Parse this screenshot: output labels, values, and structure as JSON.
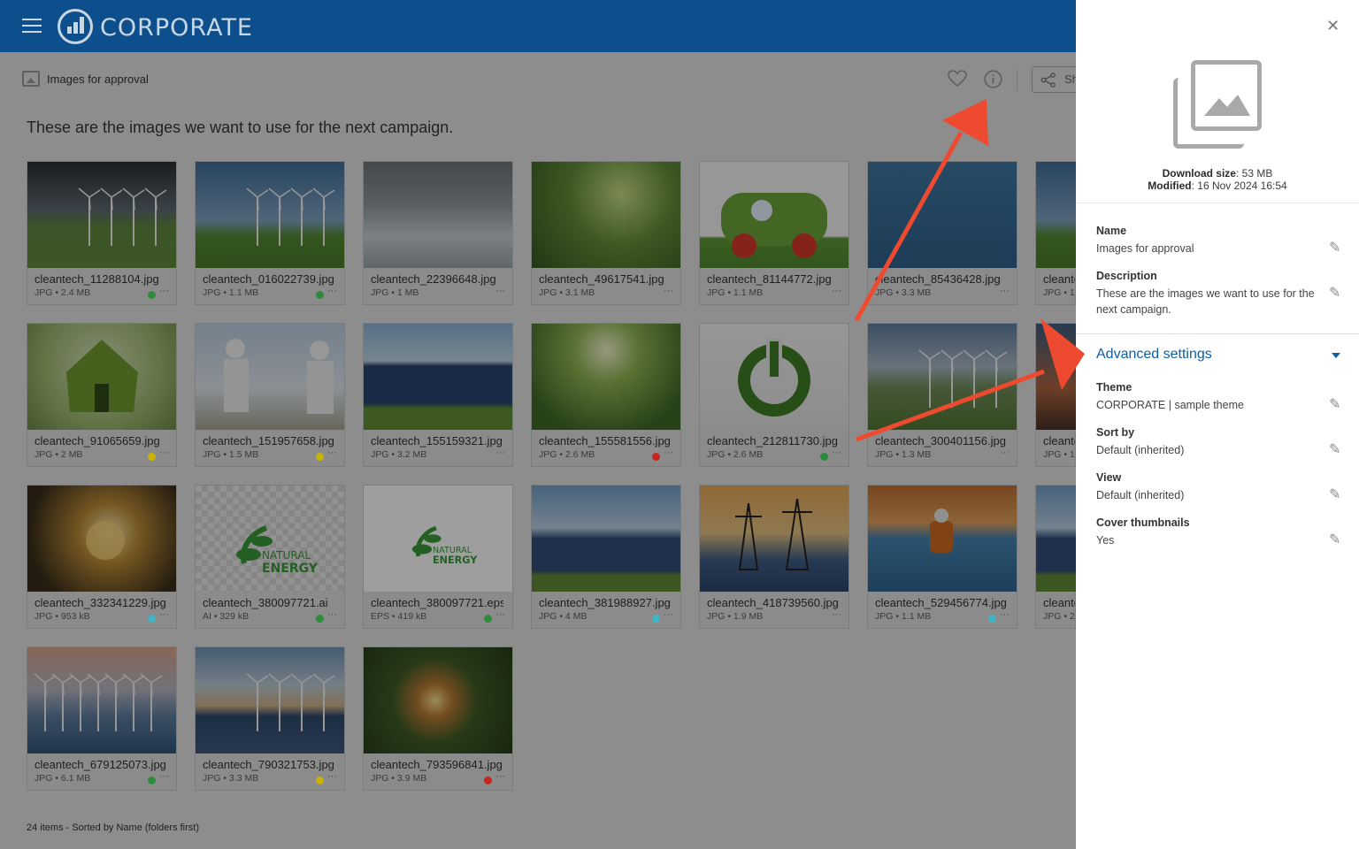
{
  "app": {
    "logo_text": "CORPORATE"
  },
  "breadcrumb": {
    "label": "Images for approval"
  },
  "toolbar": {
    "share_label": "Sh"
  },
  "description": "These are the images we want to use for the next campaign.",
  "files": [
    {
      "name": "cleantech_11288104.jpg",
      "meta": "JPG • 2.4 MB",
      "status": "#2e8b3a",
      "thumb": "storm"
    },
    {
      "name": "cleantech_016022739.jpg",
      "meta": "JPG • 1.1 MB",
      "status": "#2e8b3a",
      "thumb": "turbines"
    },
    {
      "name": "cleantech_22396648.jpg",
      "meta": "JPG • 1 MB",
      "status": "",
      "thumb": "dam"
    },
    {
      "name": "cleantech_49617541.jpg",
      "meta": "JPG • 3.1 MB",
      "status": "",
      "thumb": "forest"
    },
    {
      "name": "cleantech_81144772.jpg",
      "meta": "JPG • 1.1 MB",
      "status": "",
      "thumb": "flowercar"
    },
    {
      "name": "cleantech_85436428.jpg",
      "meta": "JPG • 3.3 MB",
      "status": "",
      "thumb": "solarsea"
    },
    {
      "name": "cleante",
      "meta": "JPG • 1",
      "status": "",
      "thumb": "turbines"
    },
    {
      "name": "cleantech_91065659.jpg",
      "meta": "JPG • 2 MB",
      "status": "#c9b200",
      "thumb": "house"
    },
    {
      "name": "cleantech_151957658.jpg",
      "meta": "JPG • 1.5 MB",
      "status": "#c9b200",
      "thumb": "engineers"
    },
    {
      "name": "cleantech_155159321.jpg",
      "meta": "JPG • 3.2 MB",
      "status": "",
      "thumb": "panels"
    },
    {
      "name": "cleantech_155581556.jpg",
      "meta": "JPG • 2.6 MB",
      "status": "#c8251f",
      "thumb": "tree"
    },
    {
      "name": "cleantech_212811730.jpg",
      "meta": "JPG • 2.6 MB",
      "status": "#2e8b3a",
      "thumb": "power"
    },
    {
      "name": "cleantech_300401156.jpg",
      "meta": "JPG • 1.3 MB",
      "status": "",
      "thumb": "hills"
    },
    {
      "name": "cleante",
      "meta": "JPG • 1",
      "status": "",
      "thumb": "sunset"
    },
    {
      "name": "cleantech_332341229.jpg",
      "meta": "JPG • 953 kB",
      "status": "#3fb5c7",
      "thumb": "bulb"
    },
    {
      "name": "cleantech_380097721.ai",
      "meta": "AI • 329 kB",
      "status": "#2e8b3a",
      "thumb": "logo1"
    },
    {
      "name": "cleantech_380097721.eps",
      "meta": "EPS • 419 kB",
      "status": "#2e8b3a",
      "thumb": "logo2"
    },
    {
      "name": "cleantech_381988927.jpg",
      "meta": "JPG • 4 MB",
      "status": "#3fb5c7",
      "thumb": "panels2"
    },
    {
      "name": "cleantech_418739560.jpg",
      "meta": "JPG • 1.9 MB",
      "status": "",
      "thumb": "pylons"
    },
    {
      "name": "cleantech_529456774.jpg",
      "meta": "JPG • 1.1 MB",
      "status": "#3fb5c7",
      "thumb": "worker"
    },
    {
      "name": "cleante",
      "meta": "JPG • 2",
      "status": "",
      "thumb": "panels2"
    },
    {
      "name": "cleantech_679125073.jpg",
      "meta": "JPG • 6.1 MB",
      "status": "#2e8b3a",
      "thumb": "offshore"
    },
    {
      "name": "cleantech_790321753.jpg",
      "meta": "JPG • 3.3 MB",
      "status": "#c9b200",
      "thumb": "desert"
    },
    {
      "name": "cleantech_793596841.jpg",
      "meta": "JPG • 3.9 MB",
      "status": "#c8251f",
      "thumb": "hands"
    }
  ],
  "footer": "24 items - Sorted by Name (folders first)",
  "panel": {
    "download_label": "Download size",
    "download_value": ": 53 MB",
    "modified_label": "Modified",
    "modified_value": ": 16 Nov 2024 16:54",
    "name_label": "Name",
    "name_value": "Images for approval",
    "desc_label": "Description",
    "desc_value": "These are the images we want to use for the next campaign.",
    "advanced_label": "Advanced settings",
    "theme_label": "Theme",
    "theme_value": "CORPORATE | sample theme",
    "sort_label": "Sort by",
    "sort_value": "Default (inherited)",
    "view_label": "View",
    "view_value": "Default (inherited)",
    "cover_label": "Cover thumbnails",
    "cover_value": "Yes"
  },
  "colors": {
    "brand": "#0d4f8c",
    "accent": "#0d5fa8",
    "arrow": "#ee4a30"
  },
  "icons": [
    "menu-icon",
    "bar-chart-logo-icon",
    "image-icon",
    "heart-icon",
    "info-icon",
    "share-icon",
    "close-icon",
    "pencil-icon",
    "caret-down-icon",
    "more-icon"
  ]
}
